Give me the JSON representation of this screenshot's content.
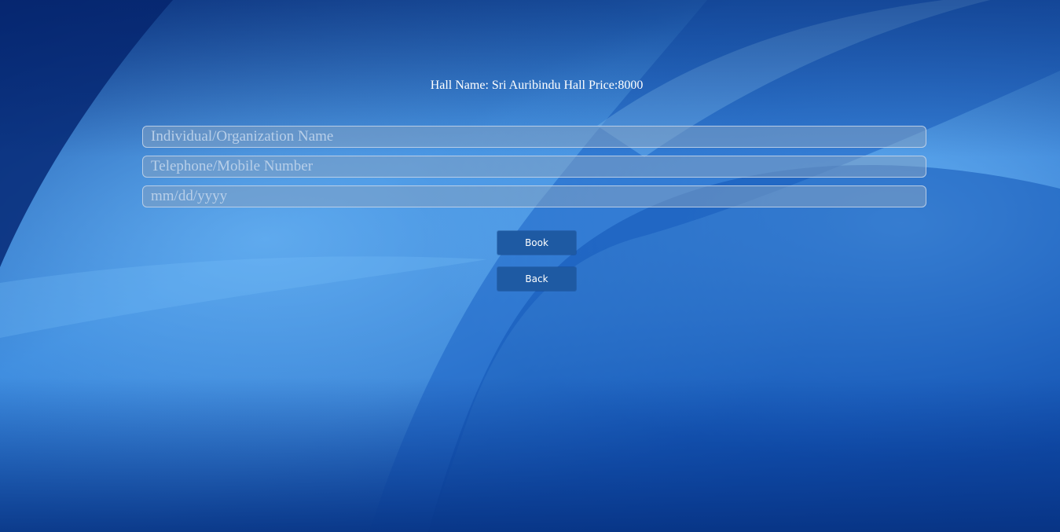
{
  "header": {
    "hall_info": "Hall Name: Sri Auribindu Hall Price:8000"
  },
  "form": {
    "name_placeholder": "Individual/Organization Name",
    "name_value": "",
    "phone_placeholder": "Telephone/Mobile Number",
    "phone_value": "",
    "date_placeholder": "mm/dd/yyyy",
    "date_value": ""
  },
  "actions": {
    "book_label": "Book",
    "back_label": "Back"
  },
  "colors": {
    "background": "#1a5bc0",
    "button": "#1e5aa3",
    "text": "#ffffff"
  }
}
